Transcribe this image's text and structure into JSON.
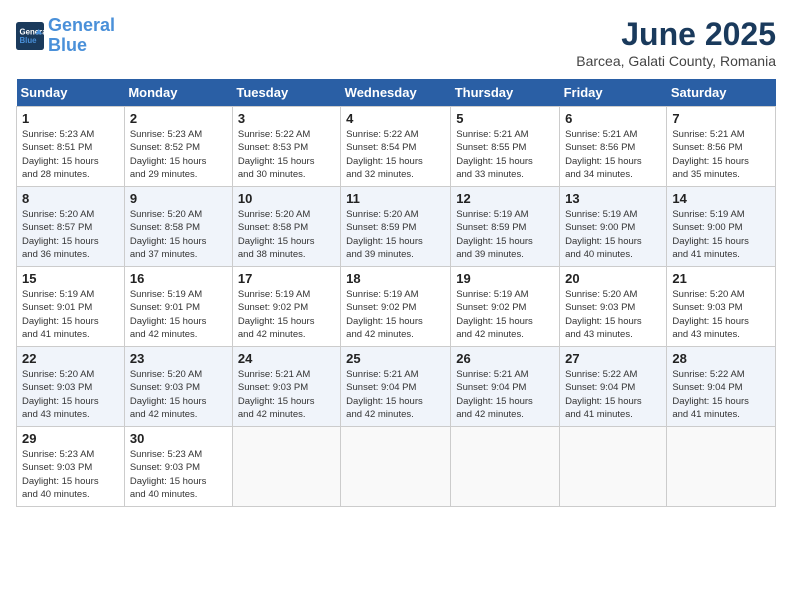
{
  "logo": {
    "line1": "General",
    "line2": "Blue"
  },
  "title": "June 2025",
  "subtitle": "Barcea, Galati County, Romania",
  "days_of_week": [
    "Sunday",
    "Monday",
    "Tuesday",
    "Wednesday",
    "Thursday",
    "Friday",
    "Saturday"
  ],
  "weeks": [
    [
      {
        "day": "1",
        "info": "Sunrise: 5:23 AM\nSunset: 8:51 PM\nDaylight: 15 hours\nand 28 minutes."
      },
      {
        "day": "2",
        "info": "Sunrise: 5:23 AM\nSunset: 8:52 PM\nDaylight: 15 hours\nand 29 minutes."
      },
      {
        "day": "3",
        "info": "Sunrise: 5:22 AM\nSunset: 8:53 PM\nDaylight: 15 hours\nand 30 minutes."
      },
      {
        "day": "4",
        "info": "Sunrise: 5:22 AM\nSunset: 8:54 PM\nDaylight: 15 hours\nand 32 minutes."
      },
      {
        "day": "5",
        "info": "Sunrise: 5:21 AM\nSunset: 8:55 PM\nDaylight: 15 hours\nand 33 minutes."
      },
      {
        "day": "6",
        "info": "Sunrise: 5:21 AM\nSunset: 8:56 PM\nDaylight: 15 hours\nand 34 minutes."
      },
      {
        "day": "7",
        "info": "Sunrise: 5:21 AM\nSunset: 8:56 PM\nDaylight: 15 hours\nand 35 minutes."
      }
    ],
    [
      {
        "day": "8",
        "info": "Sunrise: 5:20 AM\nSunset: 8:57 PM\nDaylight: 15 hours\nand 36 minutes."
      },
      {
        "day": "9",
        "info": "Sunrise: 5:20 AM\nSunset: 8:58 PM\nDaylight: 15 hours\nand 37 minutes."
      },
      {
        "day": "10",
        "info": "Sunrise: 5:20 AM\nSunset: 8:58 PM\nDaylight: 15 hours\nand 38 minutes."
      },
      {
        "day": "11",
        "info": "Sunrise: 5:20 AM\nSunset: 8:59 PM\nDaylight: 15 hours\nand 39 minutes."
      },
      {
        "day": "12",
        "info": "Sunrise: 5:19 AM\nSunset: 8:59 PM\nDaylight: 15 hours\nand 39 minutes."
      },
      {
        "day": "13",
        "info": "Sunrise: 5:19 AM\nSunset: 9:00 PM\nDaylight: 15 hours\nand 40 minutes."
      },
      {
        "day": "14",
        "info": "Sunrise: 5:19 AM\nSunset: 9:00 PM\nDaylight: 15 hours\nand 41 minutes."
      }
    ],
    [
      {
        "day": "15",
        "info": "Sunrise: 5:19 AM\nSunset: 9:01 PM\nDaylight: 15 hours\nand 41 minutes."
      },
      {
        "day": "16",
        "info": "Sunrise: 5:19 AM\nSunset: 9:01 PM\nDaylight: 15 hours\nand 42 minutes."
      },
      {
        "day": "17",
        "info": "Sunrise: 5:19 AM\nSunset: 9:02 PM\nDaylight: 15 hours\nand 42 minutes."
      },
      {
        "day": "18",
        "info": "Sunrise: 5:19 AM\nSunset: 9:02 PM\nDaylight: 15 hours\nand 42 minutes."
      },
      {
        "day": "19",
        "info": "Sunrise: 5:19 AM\nSunset: 9:02 PM\nDaylight: 15 hours\nand 42 minutes."
      },
      {
        "day": "20",
        "info": "Sunrise: 5:20 AM\nSunset: 9:03 PM\nDaylight: 15 hours\nand 43 minutes."
      },
      {
        "day": "21",
        "info": "Sunrise: 5:20 AM\nSunset: 9:03 PM\nDaylight: 15 hours\nand 43 minutes."
      }
    ],
    [
      {
        "day": "22",
        "info": "Sunrise: 5:20 AM\nSunset: 9:03 PM\nDaylight: 15 hours\nand 43 minutes."
      },
      {
        "day": "23",
        "info": "Sunrise: 5:20 AM\nSunset: 9:03 PM\nDaylight: 15 hours\nand 42 minutes."
      },
      {
        "day": "24",
        "info": "Sunrise: 5:21 AM\nSunset: 9:03 PM\nDaylight: 15 hours\nand 42 minutes."
      },
      {
        "day": "25",
        "info": "Sunrise: 5:21 AM\nSunset: 9:04 PM\nDaylight: 15 hours\nand 42 minutes."
      },
      {
        "day": "26",
        "info": "Sunrise: 5:21 AM\nSunset: 9:04 PM\nDaylight: 15 hours\nand 42 minutes."
      },
      {
        "day": "27",
        "info": "Sunrise: 5:22 AM\nSunset: 9:04 PM\nDaylight: 15 hours\nand 41 minutes."
      },
      {
        "day": "28",
        "info": "Sunrise: 5:22 AM\nSunset: 9:04 PM\nDaylight: 15 hours\nand 41 minutes."
      }
    ],
    [
      {
        "day": "29",
        "info": "Sunrise: 5:23 AM\nSunset: 9:03 PM\nDaylight: 15 hours\nand 40 minutes."
      },
      {
        "day": "30",
        "info": "Sunrise: 5:23 AM\nSunset: 9:03 PM\nDaylight: 15 hours\nand 40 minutes."
      },
      {
        "day": "",
        "info": ""
      },
      {
        "day": "",
        "info": ""
      },
      {
        "day": "",
        "info": ""
      },
      {
        "day": "",
        "info": ""
      },
      {
        "day": "",
        "info": ""
      }
    ]
  ]
}
